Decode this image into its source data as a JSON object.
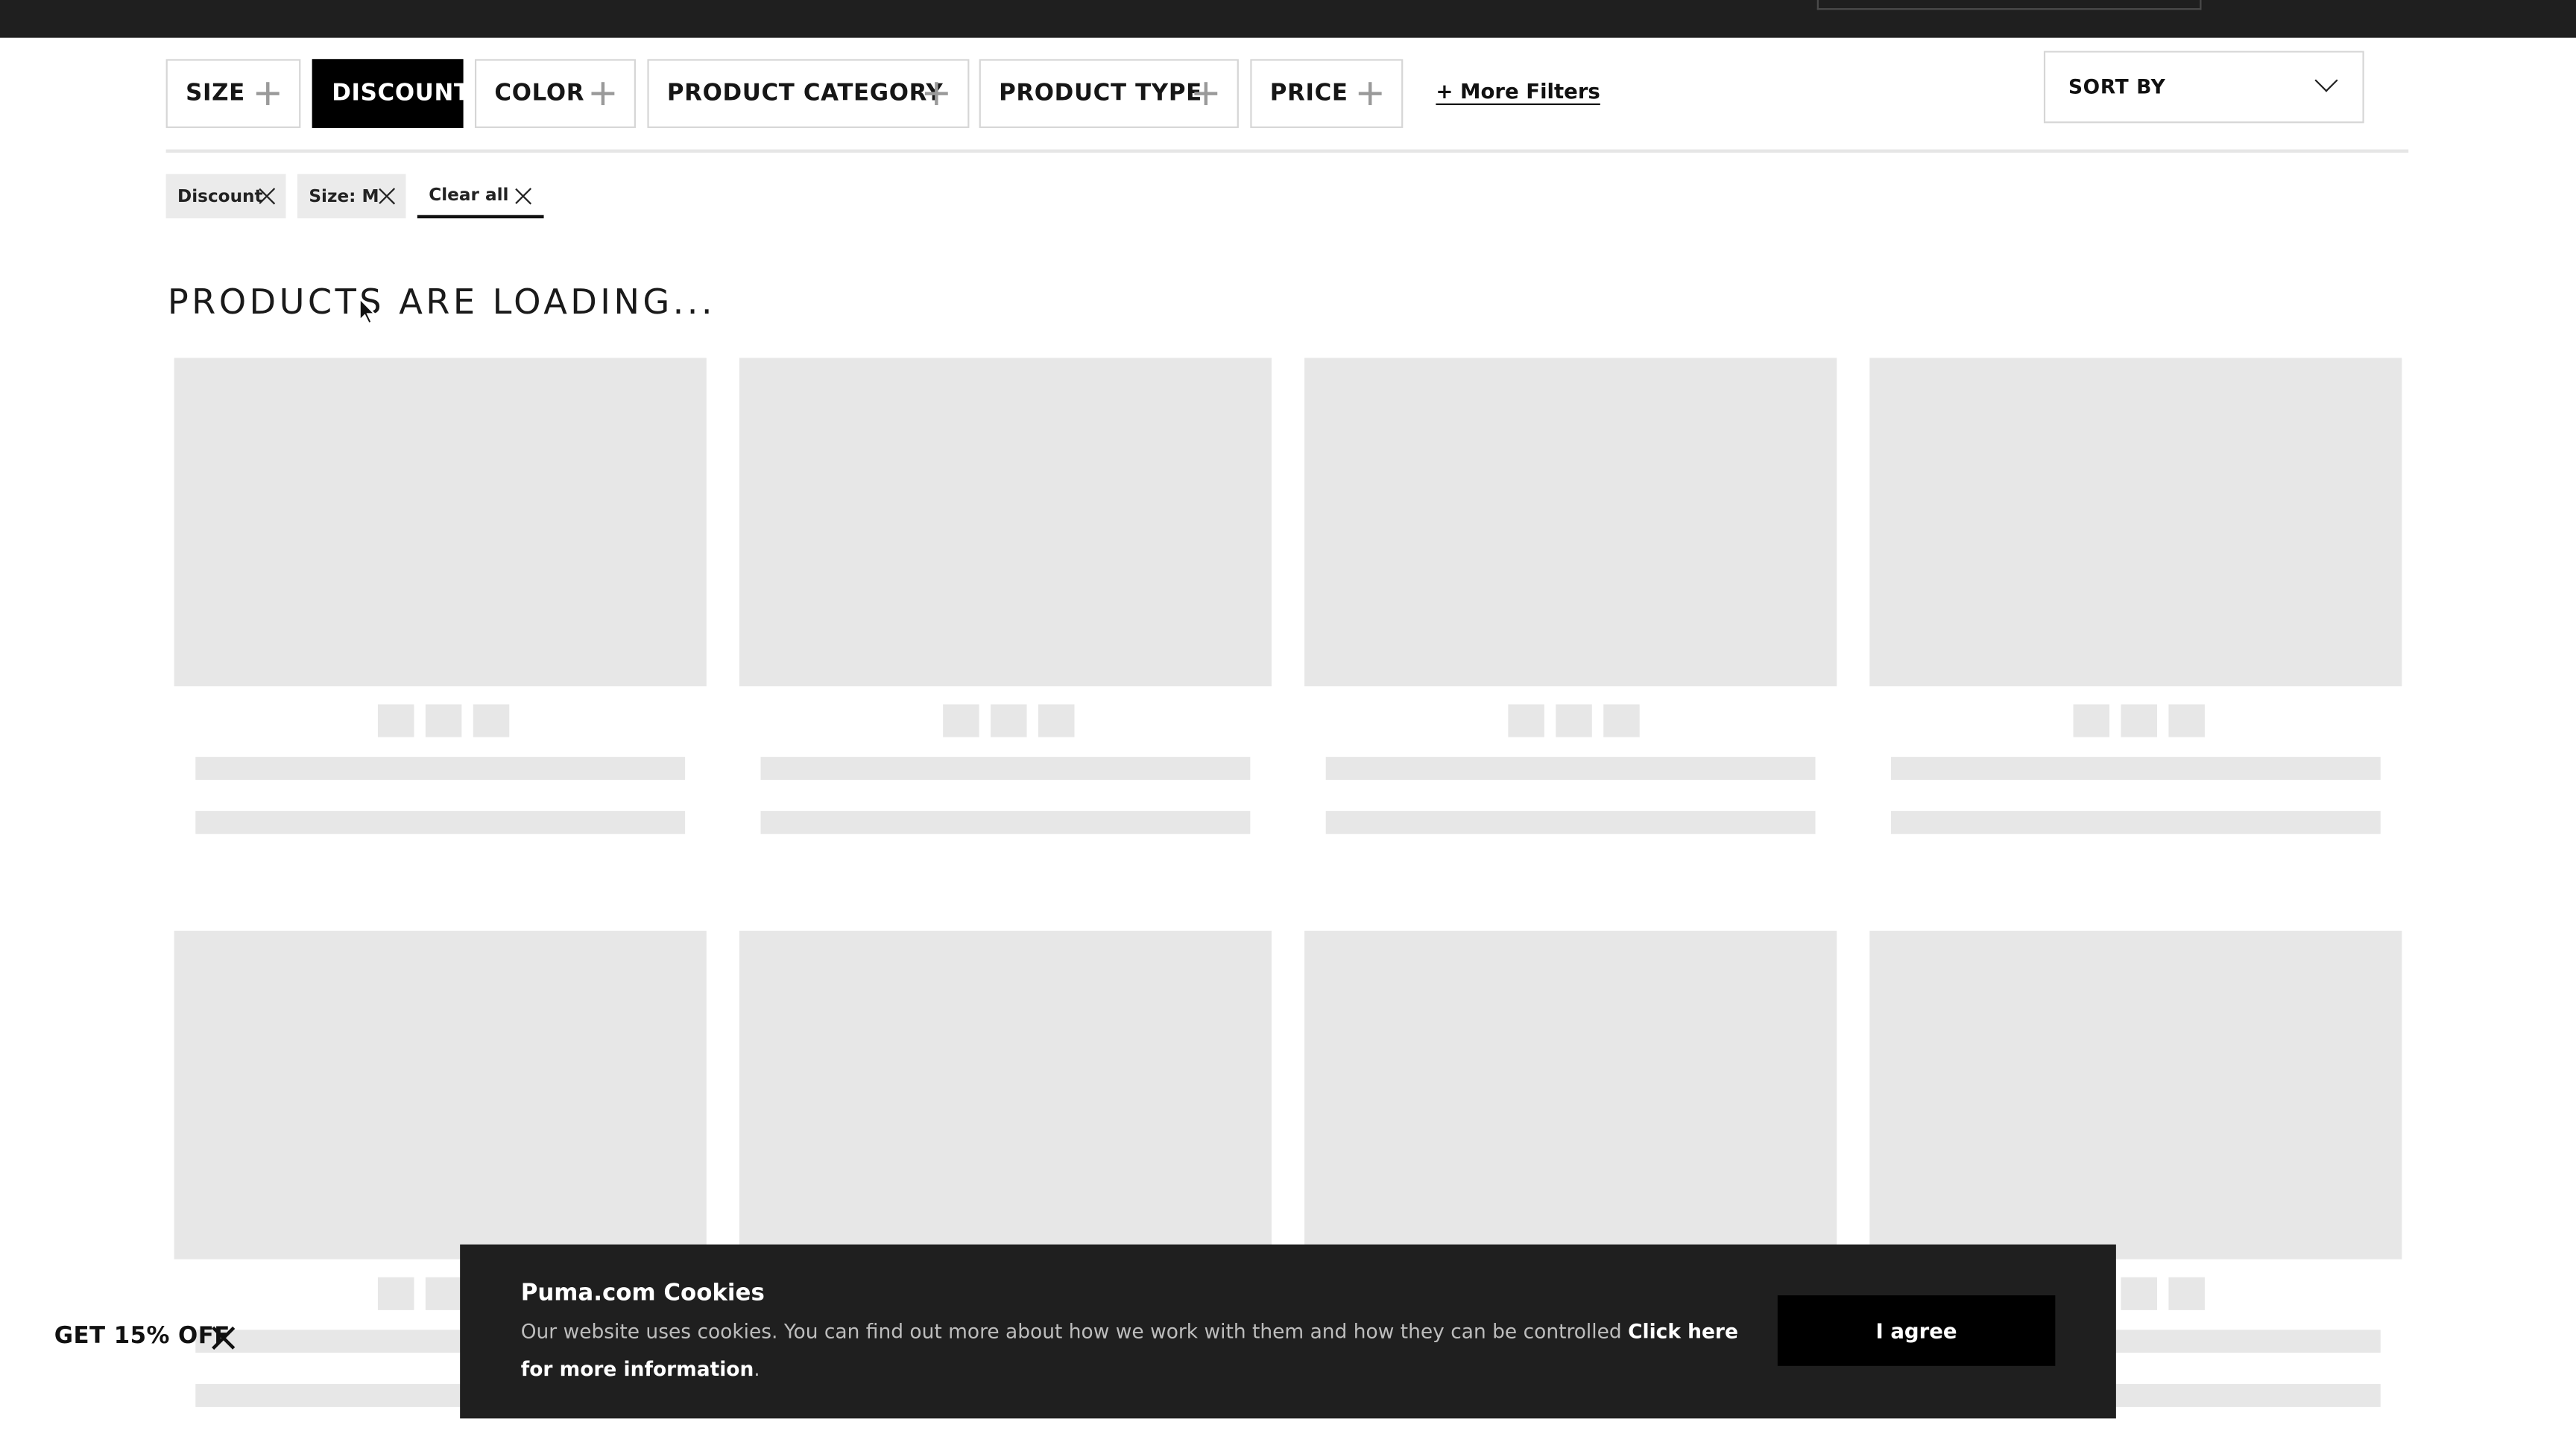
{
  "filters": {
    "chips": [
      {
        "label": "SIZE",
        "active": false
      },
      {
        "label": "DISCOUNT",
        "active": true
      },
      {
        "label": "COLOR",
        "active": false
      },
      {
        "label": "PRODUCT CATEGORY",
        "active": false
      },
      {
        "label": "PRODUCT TYPE",
        "active": false
      },
      {
        "label": "PRICE",
        "active": false
      }
    ],
    "more_filters_label": "+ More Filters",
    "sort_label": "SORT BY"
  },
  "applied_filters": {
    "tags": [
      "Discount",
      "Size: M"
    ],
    "clear_all_label": "Clear all"
  },
  "main": {
    "loading_title": "PRODUCTS ARE LOADING..."
  },
  "promo": {
    "label": "GET 15% OFF"
  },
  "cookie_banner": {
    "title": "Puma.com Cookies",
    "text": "Our website uses cookies. You can find out more about how we work with them and how they can be controlled",
    "link_label": "Click here for more information",
    "period": ".",
    "agree_label": "I agree"
  },
  "icons": {
    "chip_icon": "plus-icon",
    "sort_icon": "chevron-down-icon",
    "tag_icon": "close-icon",
    "cursor": "mouse-pointer-icon"
  },
  "colors": {
    "topbar": "#1f1f1f",
    "active_chip": "#000000",
    "skeleton": "#e7e7e7",
    "banner": "#1f1f1f"
  }
}
